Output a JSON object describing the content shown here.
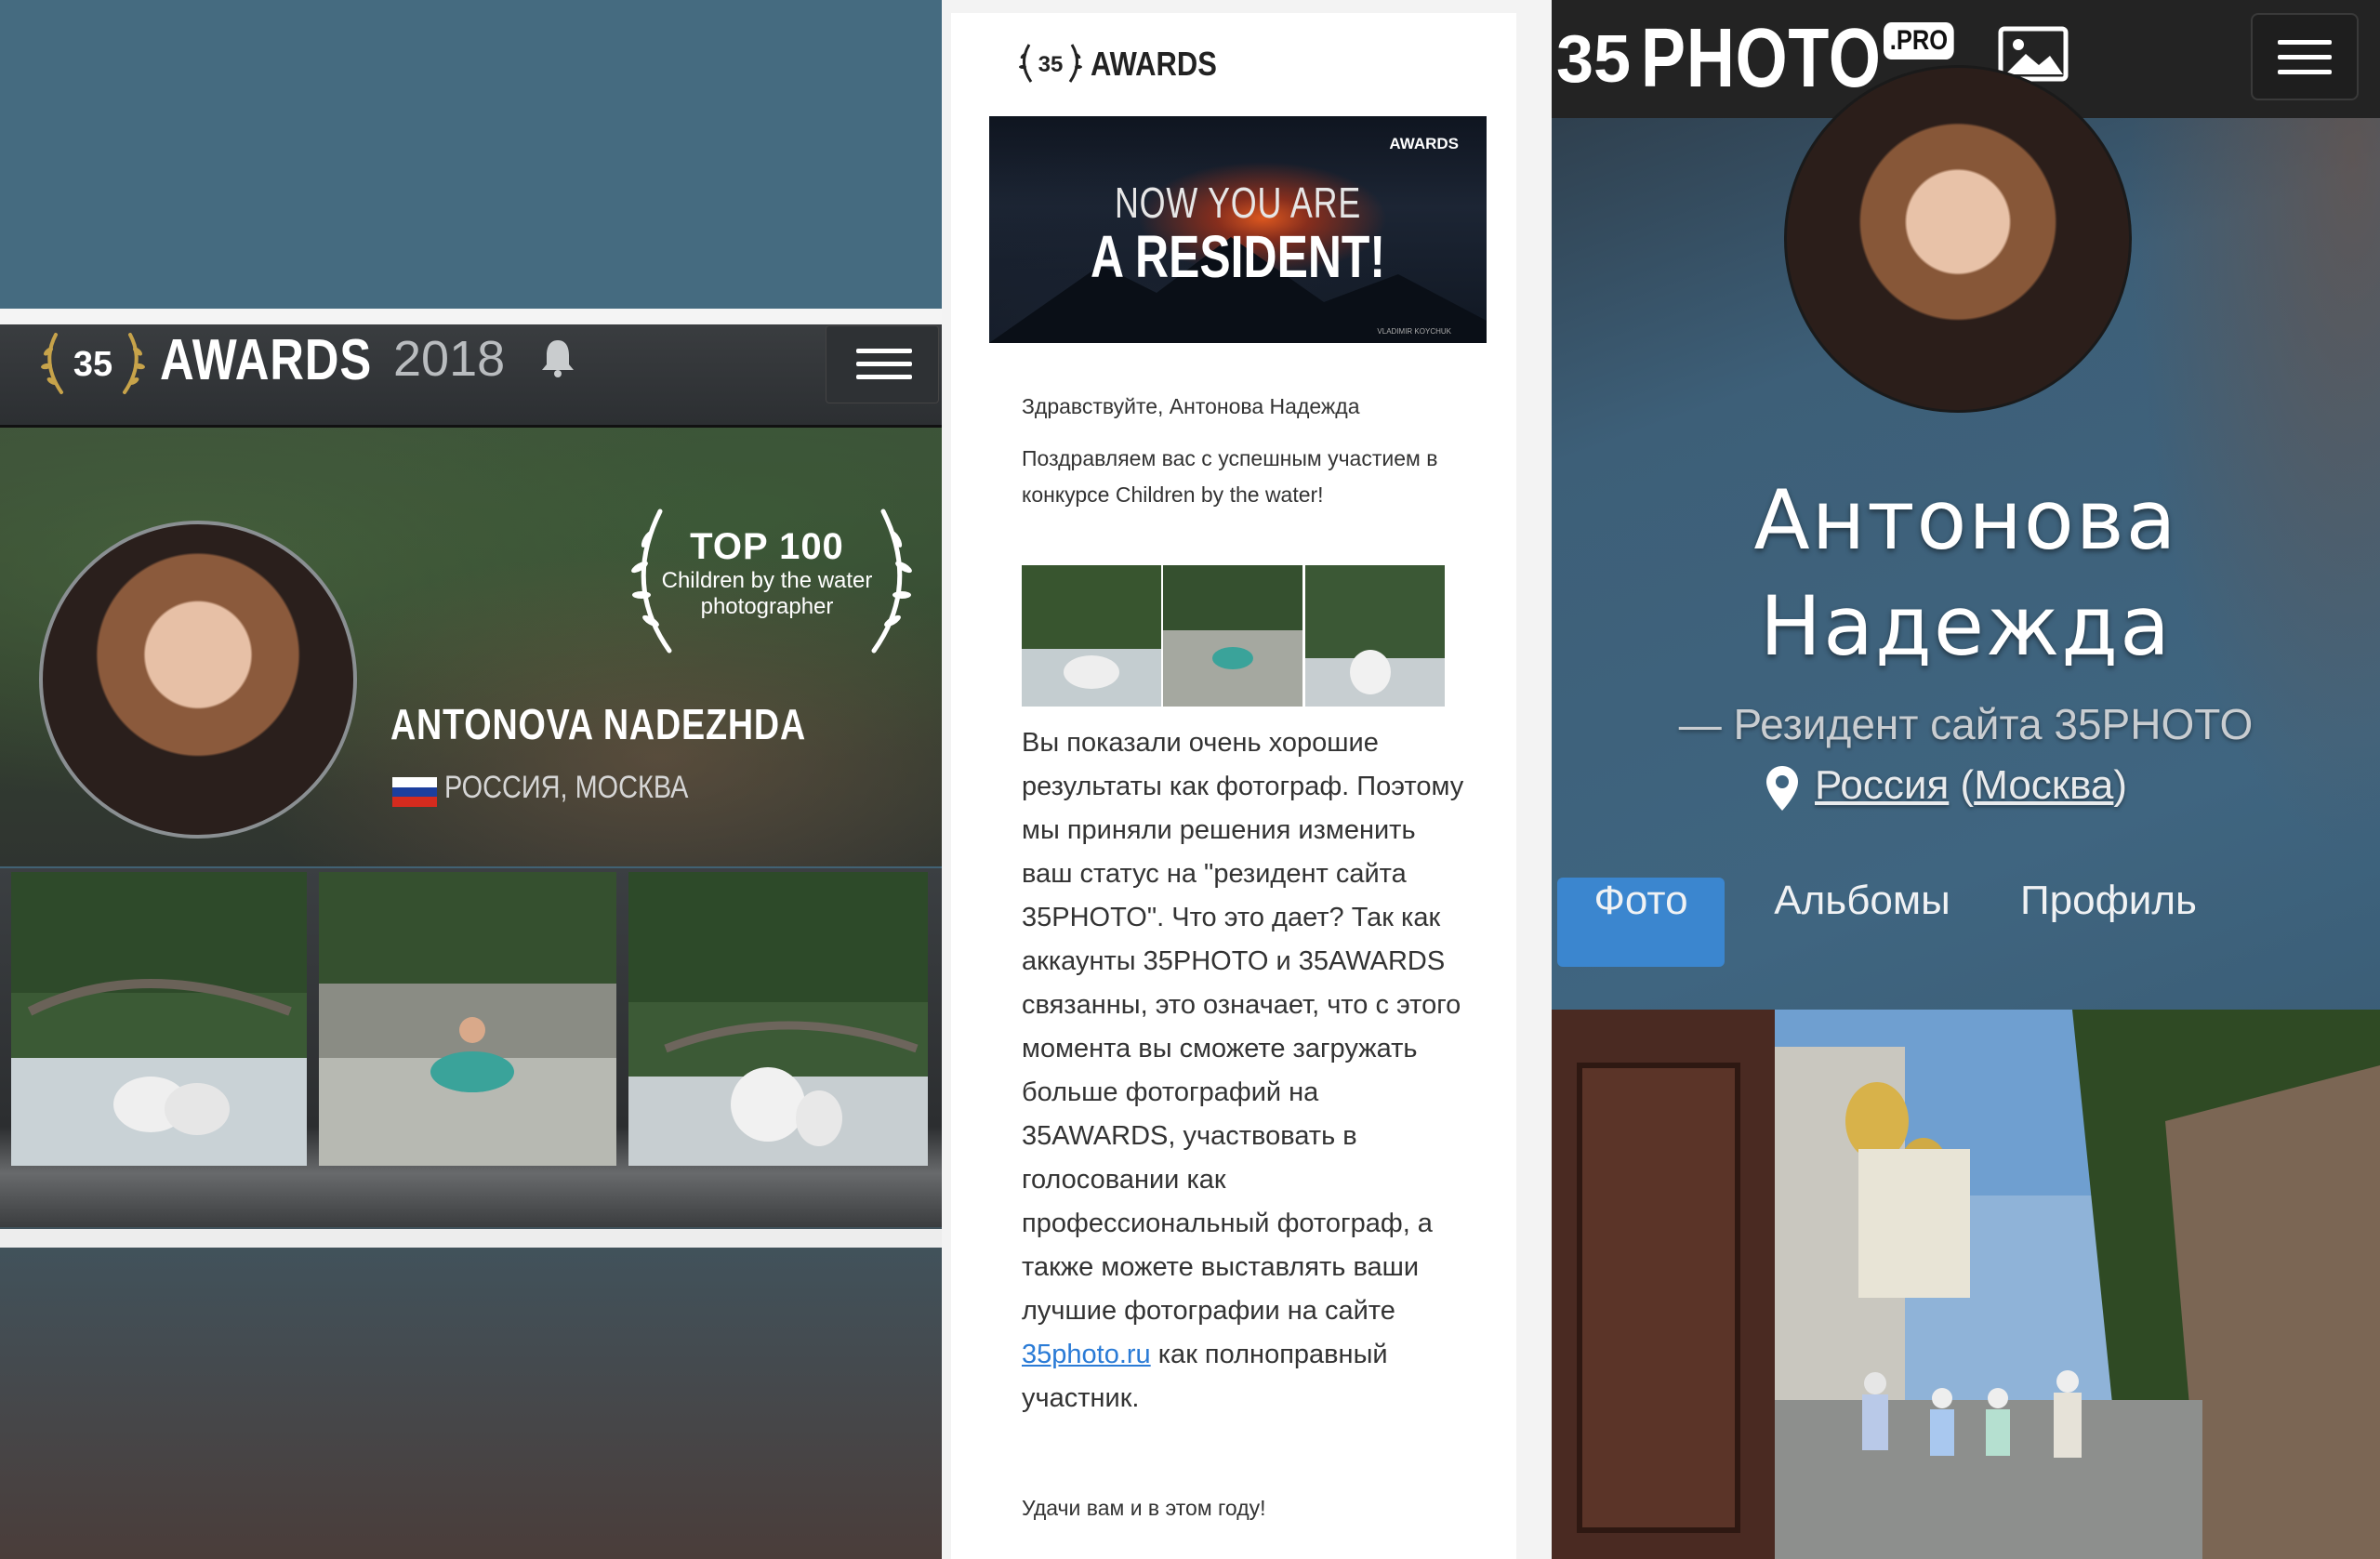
{
  "left": {
    "header": {
      "brand": "AWARDS",
      "year": "2018"
    },
    "badge": {
      "rank": "TOP 100",
      "line1": "Children by the water",
      "line2": "photographer"
    },
    "profile": {
      "name": "ANTONOVA NADEZHDA",
      "location": "РОССИЯ, МОСКВА"
    },
    "icons": [
      "awards-wreath-icon",
      "bell-icon",
      "menu-icon",
      "russia-flag-icon"
    ],
    "colors": {
      "header": "#2e3134",
      "page": "#456b80"
    }
  },
  "middle": {
    "header": {
      "brand": "AWARDS"
    },
    "banner": {
      "brand": "AWARDS",
      "line1": "NOW YOU ARE",
      "line2": "A RESIDENT!",
      "credit": "VLADIMIR KOYCHUK"
    },
    "greeting": "Здравствуйте, Антонова Надежда",
    "congrats": "Поздравляем вас с успешным участием в конкурсе Children by the water!",
    "body_main": "Вы показали очень хорошие результаты как фотограф. Поэтому мы приняли решения изменить ваш статус на \"резидент сайта 35PHOTO\". Что это дает? Так как аккаунты 35PHOTO и 35AWARDS связанны, это означает, что с этого момента вы сможете загружать больше фотографий на 35AWARDS, участвовать в голосовании как профессиональный фотограф, а также можете выставлять ваши лучшие фотографии на сайте",
    "link": "35photo.ru",
    "body_tail": "как полноправный участник.",
    "closing": "Удачи вам и в этом году!"
  },
  "right": {
    "header": {
      "brand": "PHOTO",
      "badge": ".PRO"
    },
    "profile": {
      "name_line1": "Антонова",
      "name_line2": "Надежда",
      "status": "— Резидент сайта 35PHOTO",
      "country": "Россия",
      "city": "Москва"
    },
    "tabs": [
      {
        "label": "Фото",
        "active": true
      },
      {
        "label": "Альбомы",
        "active": false
      },
      {
        "label": "Профиль",
        "active": false
      }
    ],
    "icons": [
      "gallery-icon",
      "menu-icon",
      "location-pin-icon"
    ],
    "colors": {
      "active_tab": "#3b86cf",
      "header": "#232323"
    }
  }
}
